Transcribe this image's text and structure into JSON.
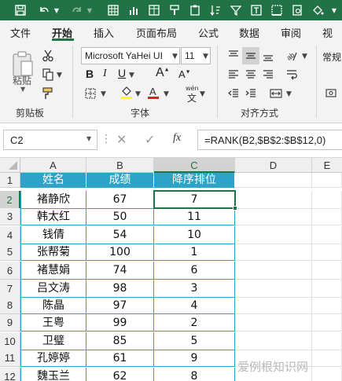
{
  "tabs": [
    "文件",
    "开始",
    "插入",
    "页面布局",
    "公式",
    "数据",
    "审阅",
    "视图"
  ],
  "active_tab": "开始",
  "ribbon": {
    "paste_label": "粘贴",
    "font_name": "Microsoft YaHei UI",
    "font_size": "11",
    "wen_label": "wén",
    "number_format": "常规",
    "groups": {
      "clipboard": "剪贴板",
      "font": "字体",
      "alignment": "对齐方式"
    }
  },
  "formula_bar": {
    "name_box": "C2",
    "fx": "fx",
    "formula": "=RANK(B2,$B$2:$B$12,0)"
  },
  "columns": [
    "A",
    "B",
    "C",
    "D",
    "E"
  ],
  "rows": [
    "1",
    "2",
    "3",
    "4",
    "5",
    "6",
    "7",
    "8",
    "9",
    "10",
    "11",
    "12"
  ],
  "table": {
    "headers": [
      "姓名",
      "成绩",
      "降序排位"
    ],
    "rows": [
      [
        "褚静欣",
        "67",
        "7"
      ],
      [
        "韩太红",
        "50",
        "11"
      ],
      [
        "钱倩",
        "54",
        "10"
      ],
      [
        "张帮菊",
        "100",
        "1"
      ],
      [
        "褚慧娟",
        "74",
        "6"
      ],
      [
        "吕文涛",
        "98",
        "3"
      ],
      [
        "陈晶",
        "97",
        "4"
      ],
      [
        "王粤",
        "99",
        "2"
      ],
      [
        "卫璧",
        "85",
        "5"
      ],
      [
        "孔婷婷",
        "61",
        "9"
      ],
      [
        "魏玉兰",
        "62",
        "8"
      ]
    ]
  },
  "watermark": "爱例根知识网",
  "colors": {
    "excel_green": "#217346",
    "table_header": "#2ea3c9"
  }
}
